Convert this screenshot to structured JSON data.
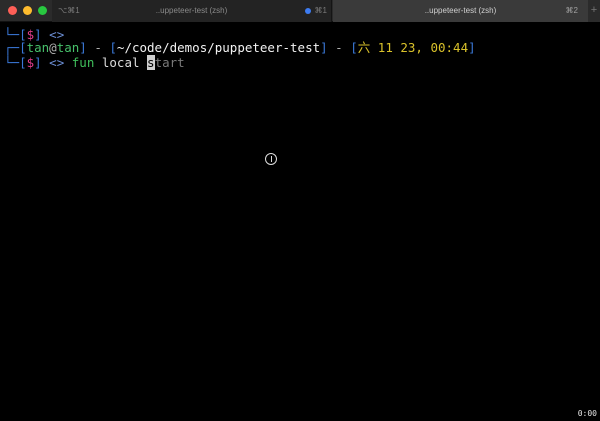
{
  "window": {
    "tabs": [
      {
        "shortcut_left": "⌥⌘1",
        "title": "..uppeteer-test (zsh)",
        "shortcut_right": "⌘1",
        "active": false
      },
      {
        "title": "..uppeteer-test (zsh)",
        "shortcut_right": "⌘2",
        "active": true
      }
    ],
    "new_tab_label": "+"
  },
  "terminal": {
    "line1": {
      "prefix": "└─",
      "bracket_open": "[",
      "symbol": "$",
      "bracket_close": "]",
      "arrows": " <>"
    },
    "line2": {
      "prefix": "┌─",
      "user": "tan",
      "at": "@",
      "host": "tan",
      "sep1": " - ",
      "path": "~/code/demos/puppeteer-test",
      "sep2": " - ",
      "date": "六 11 23, 00:44"
    },
    "line3": {
      "prefix": "└─",
      "symbol": "$",
      "arrows": " <> ",
      "command": "fun",
      "argument": " local ",
      "cursor_char": "s",
      "suggestion": "tart"
    }
  },
  "recording_timer": "0:00",
  "colors": {
    "background": "#000000",
    "prompt_box": "#3a78d8",
    "user": "#46c06a",
    "date": "#d9c12a",
    "command": "#3fbf5b"
  }
}
